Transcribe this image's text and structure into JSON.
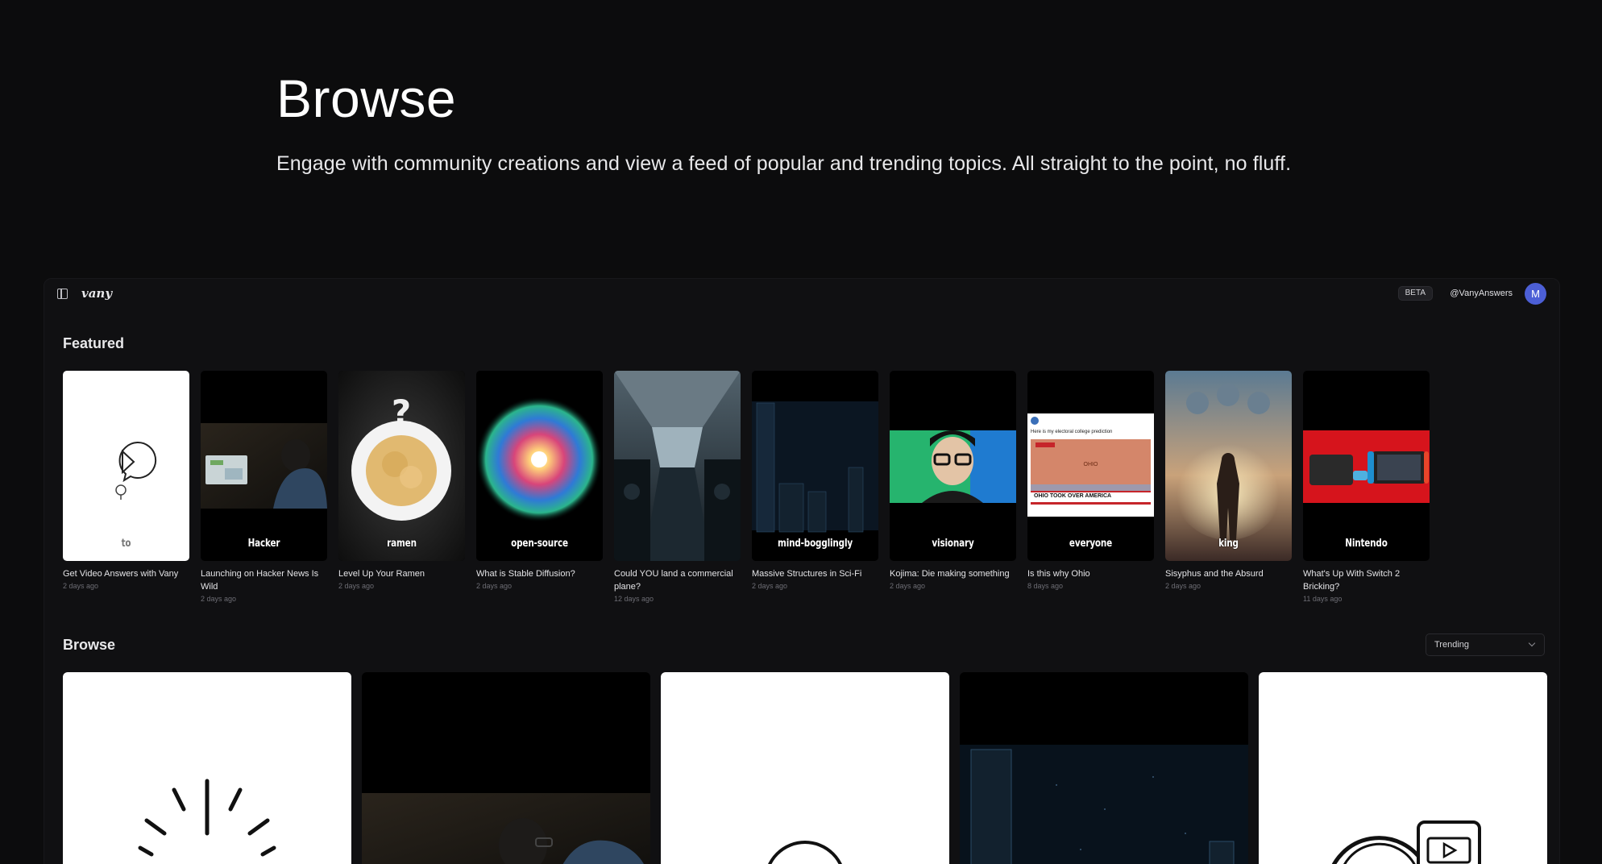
{
  "hero": {
    "title": "Browse",
    "subtitle": "Engage with community creations and view a feed of popular and trending topics. All straight to the point, no fluff."
  },
  "app": {
    "logo": "vany",
    "beta": "BETA",
    "handle": "@VanyAnswers",
    "avatar": "M"
  },
  "featured": {
    "title": "Featured",
    "items": [
      {
        "word": "to",
        "caption": "Get Video Answers with Vany",
        "date": "2 days ago",
        "icon": "play-chat-icon"
      },
      {
        "word": "Hacker",
        "caption": "Launching on Hacker News Is Wild",
        "date": "2 days ago",
        "icon": "laptop-person-image"
      },
      {
        "word": "ramen",
        "caption": "Level Up Your Ramen",
        "date": "2 days ago",
        "icon": "ramen-bowl-image"
      },
      {
        "word": "open-source",
        "caption": "What is Stable Diffusion?",
        "date": "2 days ago",
        "icon": "color-burst-image"
      },
      {
        "word": "",
        "caption": "Could YOU land a commercial plane?",
        "date": "12 days ago",
        "icon": "airplane-cabin-image"
      },
      {
        "word": "mind-bogglingly",
        "caption": "Massive Structures in Sci-Fi",
        "date": "2 days ago",
        "icon": "dark-structures-image"
      },
      {
        "word": "visionary",
        "caption": "Kojima: Die making something",
        "date": "2 days ago",
        "icon": "portrait-image"
      },
      {
        "word": "everyone",
        "caption": "Is this why Ohio",
        "date": "8 days ago",
        "icon": "election-map-image"
      },
      {
        "word": "king",
        "caption": "Sisyphus and the Absurd",
        "date": "2 days ago",
        "icon": "figure-clouds-image"
      },
      {
        "word": "Nintendo",
        "caption": "What's Up With Switch 2 Bricking?",
        "date": "11 days ago",
        "icon": "console-image"
      }
    ]
  },
  "tweet": {
    "headline": "Ohio took over America",
    "map_label": "OHIO",
    "line": "Here is my electoral college prediction"
  },
  "browse": {
    "title": "Browse",
    "sort_selected": "Trending"
  },
  "colors": {
    "background": "#0c0c0d",
    "panel": "#101012",
    "accent_avatar": "#4c5fd6"
  }
}
